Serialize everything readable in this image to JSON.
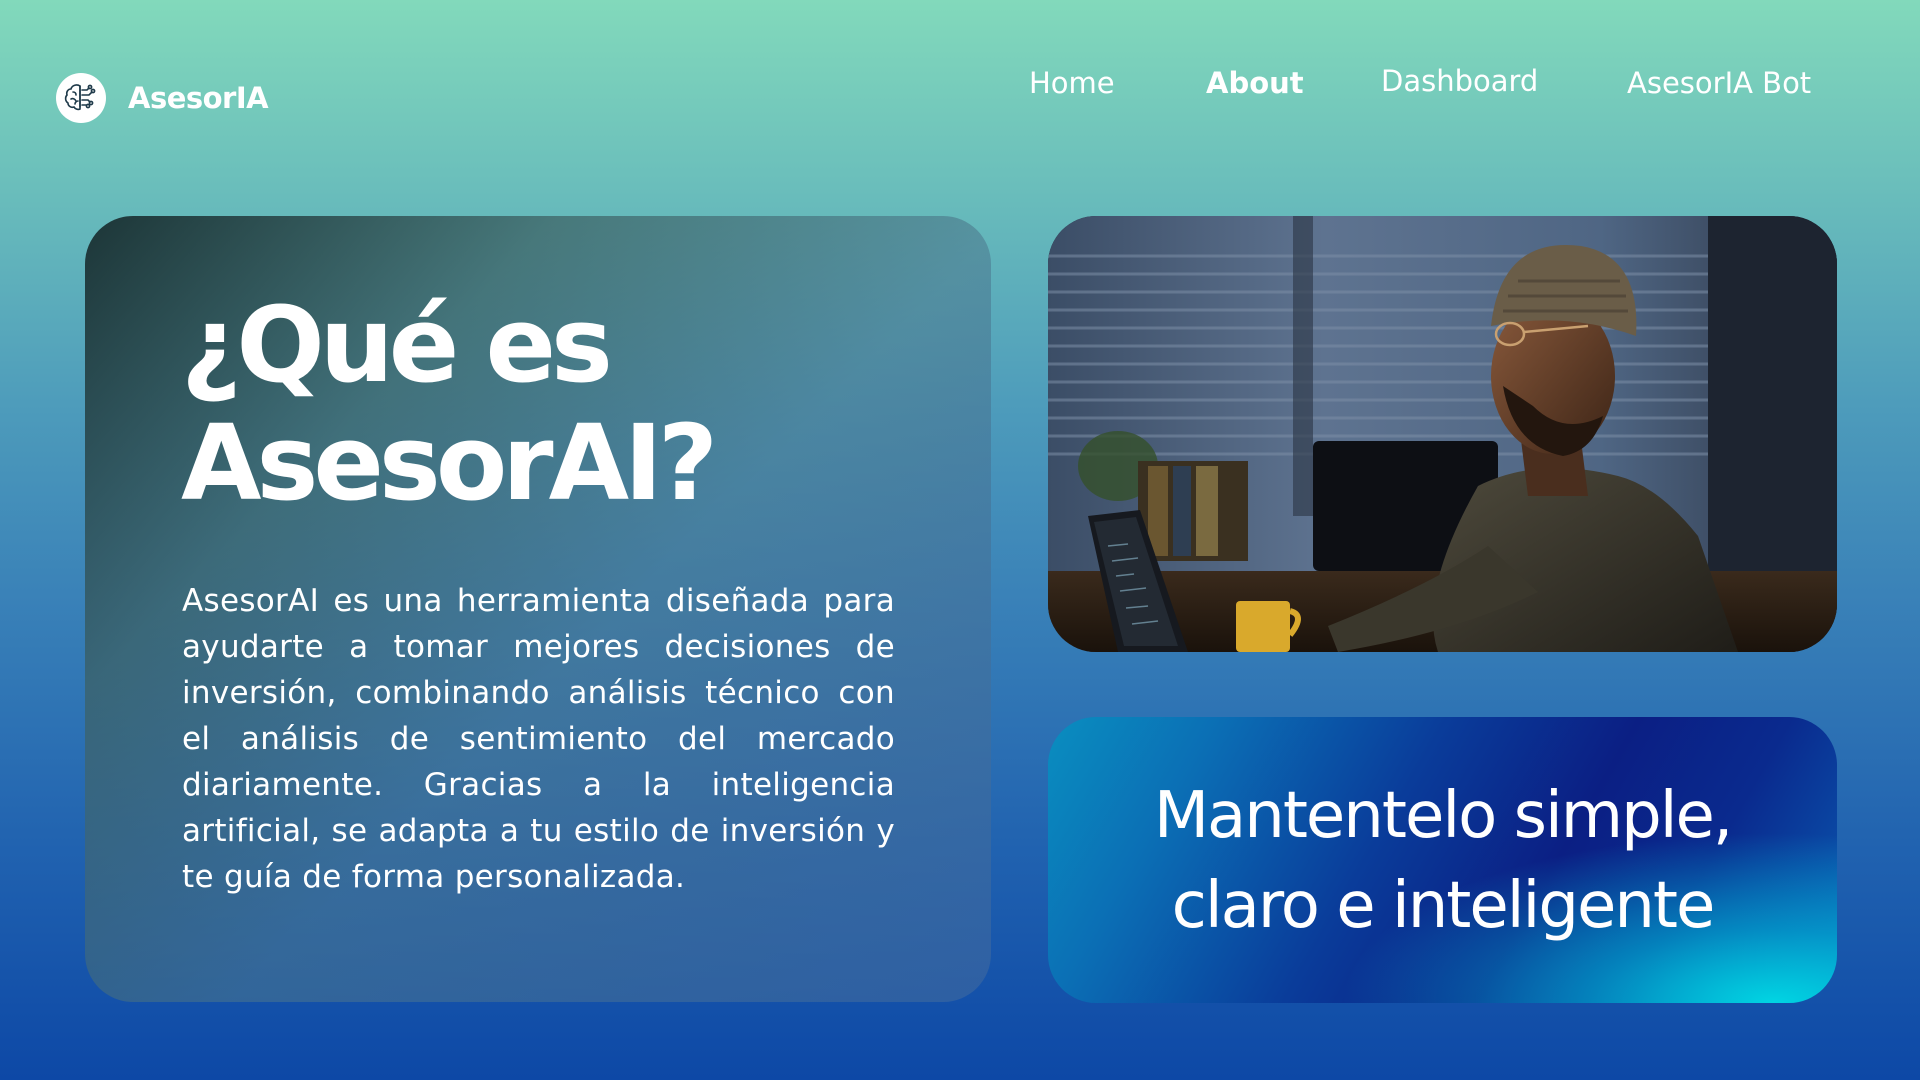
{
  "brand": {
    "name": "AsesorIA",
    "logo_icon": "brain-circuit-icon"
  },
  "nav": {
    "items": [
      {
        "label": "Home",
        "active": false
      },
      {
        "label": "About",
        "active": true
      },
      {
        "label": "Dashboard",
        "active": false
      },
      {
        "label": "AsesorIA Bot",
        "active": false
      }
    ]
  },
  "info": {
    "title": "¿Qué es\nAsesorAI?",
    "body": "AsesorAI es una herramienta diseñada para ayudarte a tomar mejores decisiones de inversión, combinando análisis técnico con el análisis de sentimiento del mercado diariamente. Gracias a la inteligencia artificial, se adapta a tu estilo de inversión y te guía de forma personalizada."
  },
  "photo": {
    "subject": "man-with-beanie-working-on-laptop-photo"
  },
  "slogan": {
    "text": "Mantentelo simple,\nclaro e inteligente"
  },
  "colors": {
    "background_top": "#82d9bb",
    "background_bottom": "#0d48a6",
    "text": "#ffffff",
    "slogan_deep_blue": "#0b1f84",
    "slogan_cyan": "#00dce6"
  }
}
